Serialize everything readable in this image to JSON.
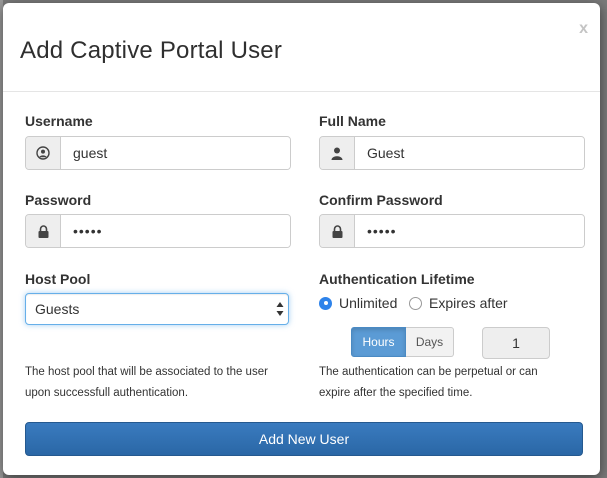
{
  "dialog": {
    "title": "Add Captive Portal User",
    "close_label": "x"
  },
  "form": {
    "username": {
      "label": "Username",
      "value": "guest",
      "icon": "user-circle-icon"
    },
    "full_name": {
      "label": "Full Name",
      "value": "Guest",
      "icon": "user-icon"
    },
    "password": {
      "label": "Password",
      "value": "•••••",
      "icon": "lock-icon"
    },
    "confirm_password": {
      "label": "Confirm Password",
      "value": "•••••",
      "icon": "lock-icon"
    },
    "host_pool": {
      "label": "Host Pool",
      "selected": "Guests",
      "help": "The host pool that will be associated to the user upon successfull authentication."
    },
    "auth_lifetime": {
      "label": "Authentication Lifetime",
      "options": [
        "Unlimited",
        "Expires after"
      ],
      "selected_option": "Unlimited",
      "units": [
        "Hours",
        "Days"
      ],
      "selected_unit": "Hours",
      "amount": "1",
      "help": "The authentication can be perpetual or can expire after the specified time."
    },
    "submit_label": "Add New User"
  },
  "colors": {
    "primary": "#2a6bad",
    "radio_selected": "#2e83ea",
    "hours_active": "#5b9bd5"
  }
}
